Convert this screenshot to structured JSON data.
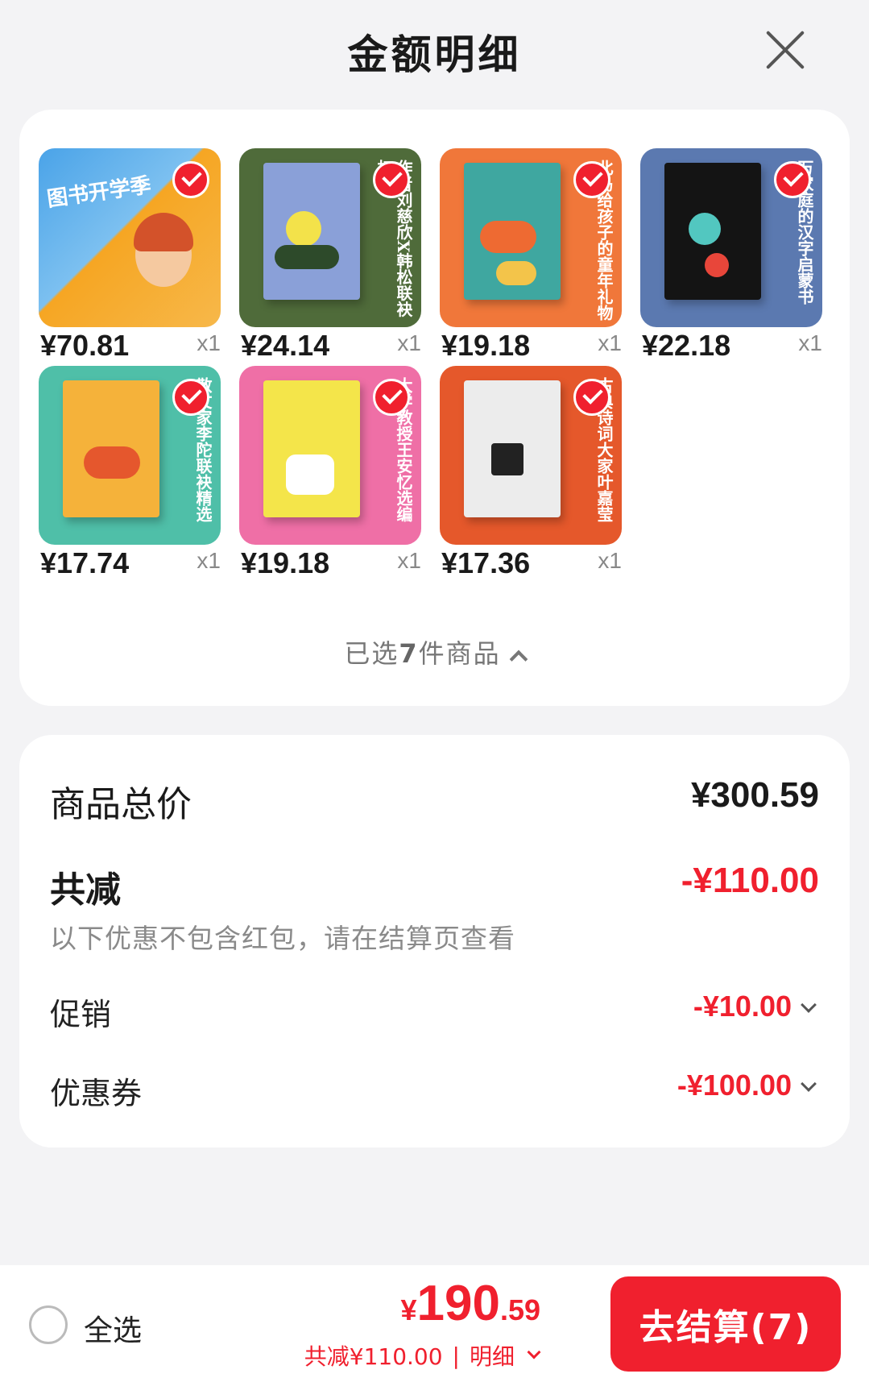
{
  "header": {
    "title": "金额明细"
  },
  "products": {
    "items": [
      {
        "price": "¥70.81",
        "qty": "x1",
        "cover_color": "#f6a623",
        "cover_text": "图书开学季"
      },
      {
        "price": "¥24.14",
        "qty": "x1",
        "cover_color": "#4f6b3a",
        "cover_text": "作者刘慈欣X韩松联袂打造"
      },
      {
        "price": "¥19.18",
        "qty": "x1",
        "cover_color": "#f0773a",
        "cover_text": "北岛给孩子的童年礼物"
      },
      {
        "price": "¥22.18",
        "qty": "x1",
        "cover_color": "#5b79b0",
        "cover_text": "万家庭的汉字启蒙书"
      },
      {
        "price": "¥17.74",
        "qty": "x1",
        "cover_color": "#4fbfa8",
        "cover_text": "散文家李陀联袂精选"
      },
      {
        "price": "¥19.18",
        "qty": "x1",
        "cover_color": "#ef6fa6",
        "cover_text": "大学教授王安忆选编"
      },
      {
        "price": "¥17.36",
        "qty": "x1",
        "cover_color": "#e5582b",
        "cover_text": "古典诗词大家叶嘉莹"
      }
    ],
    "summary_prefix": "已选",
    "summary_count": "7",
    "summary_suffix": "件商品"
  },
  "totals": {
    "total_label": "商品总价",
    "total_value": "¥300.59",
    "reduce_label": "共减",
    "reduce_value": "-¥110.00",
    "note": "以下优惠不包含红包，请在结算页查看",
    "promo_label": "促销",
    "promo_value": "-¥10.00",
    "coupon_label": "优惠券",
    "coupon_value": "-¥100.00"
  },
  "bottom": {
    "select_all": "全选",
    "currency": "¥",
    "amount_int": "190",
    "amount_dec": ".59",
    "reduce_text": "共减¥110.00",
    "separator": "|",
    "detail_text": "明细",
    "checkout_label": "去结算(7)"
  },
  "colors": {
    "accent": "#f0202e",
    "background": "#f3f3f5"
  }
}
